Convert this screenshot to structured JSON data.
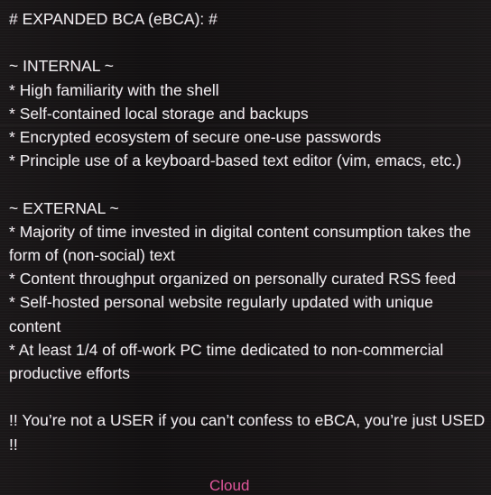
{
  "heading": "# EXPANDED BCA (eBCA): #",
  "internal": {
    "title": "~ INTERNAL ~",
    "items": [
      "* High familiarity with the shell",
      "* Self-contained local storage and backups",
      "* Encrypted ecosystem of secure one-use passwords",
      "* Principle use of a keyboard-based text editor (vim, emacs, etc.)"
    ]
  },
  "external": {
    "title": "~ EXTERNAL ~",
    "items": [
      "* Majority of time invested in digital content consumption takes the form of (non-social) text",
      "* Content throughput organized on personally curated RSS feed",
      "* Self-hosted personal website regularly updated with unique content",
      "* At least 1/4 of off-work PC time dedicated to non-commercial productive efforts"
    ]
  },
  "footer_note": "!! You’re not a USER if you can’t confess to eBCA, you’re just USED !!",
  "bottom_link": "Cloud",
  "colors": {
    "background": "#141214",
    "text": "#ededed",
    "link": "#e0569b"
  }
}
